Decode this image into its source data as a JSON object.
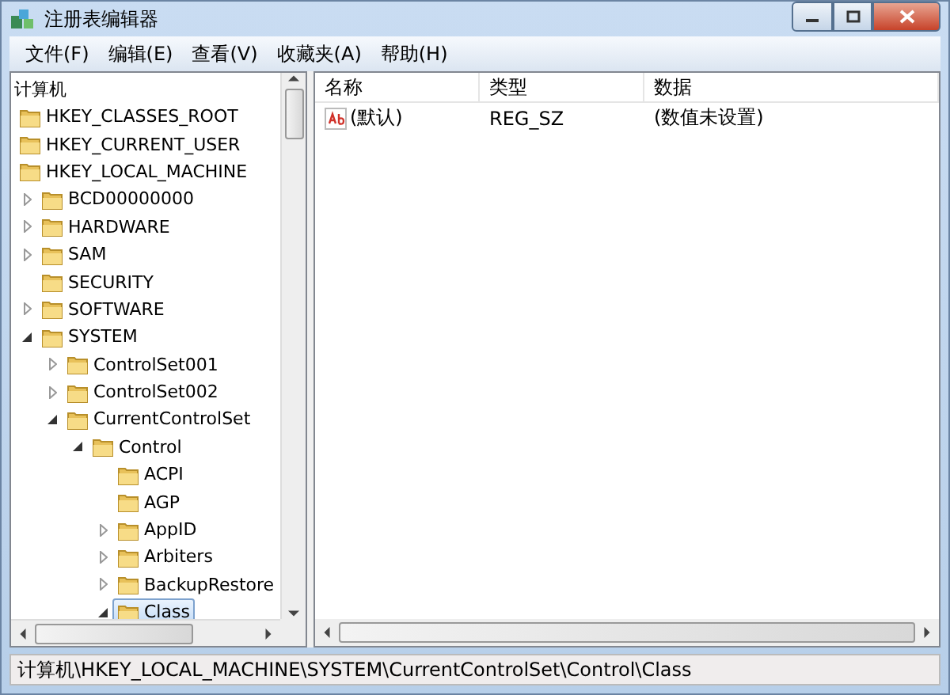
{
  "window": {
    "title": "注册表编辑器"
  },
  "menu": [
    "文件(F)",
    "编辑(E)",
    "查看(V)",
    "收藏夹(A)",
    "帮助(H)"
  ],
  "tree": {
    "root_label": "计算机",
    "items": [
      {
        "label": "HKEY_CLASSES_ROOT",
        "selected": false
      },
      {
        "label": "HKEY_CURRENT_USER",
        "selected": false
      },
      {
        "label": "HKEY_LOCAL_MACHINE",
        "selected": false,
        "children": [
          {
            "label": "BCD00000000",
            "selected": false,
            "expanded": false
          },
          {
            "label": "HARDWARE",
            "selected": false,
            "expanded": false
          },
          {
            "label": "SAM",
            "selected": false,
            "expanded": false
          },
          {
            "label": "SECURITY",
            "selected": false
          },
          {
            "label": "SOFTWARE",
            "selected": false,
            "expanded": false
          },
          {
            "label": "SYSTEM",
            "selected": false,
            "expanded": true,
            "children": [
              {
                "label": "ControlSet001",
                "selected": false,
                "expanded": false
              },
              {
                "label": "ControlSet002",
                "selected": false,
                "expanded": false
              },
              {
                "label": "CurrentControlSet",
                "selected": false,
                "expanded": true,
                "children": [
                  {
                    "label": "Control",
                    "selected": false,
                    "expanded": true,
                    "children": [
                      {
                        "label": "ACPI",
                        "selected": false
                      },
                      {
                        "label": "AGP",
                        "selected": false
                      },
                      {
                        "label": "AppID",
                        "selected": false,
                        "expanded": false
                      },
                      {
                        "label": "Arbiters",
                        "selected": false,
                        "expanded": false
                      },
                      {
                        "label": "BackupRestore",
                        "selected": false,
                        "expanded": false
                      },
                      {
                        "label": "Class",
                        "selected": true,
                        "expanded": true
                      }
                    ]
                  }
                ]
              }
            ]
          }
        ]
      }
    ]
  },
  "values": {
    "columns": [
      "名称",
      "类型",
      "数据"
    ],
    "rows": [
      {
        "name": "(默认)",
        "type": "REG_SZ",
        "data": "(数值未设置)"
      }
    ]
  },
  "status_bar": "计算机\\HKEY_LOCAL_MACHINE\\SYSTEM\\CurrentControlSet\\Control\\Class"
}
